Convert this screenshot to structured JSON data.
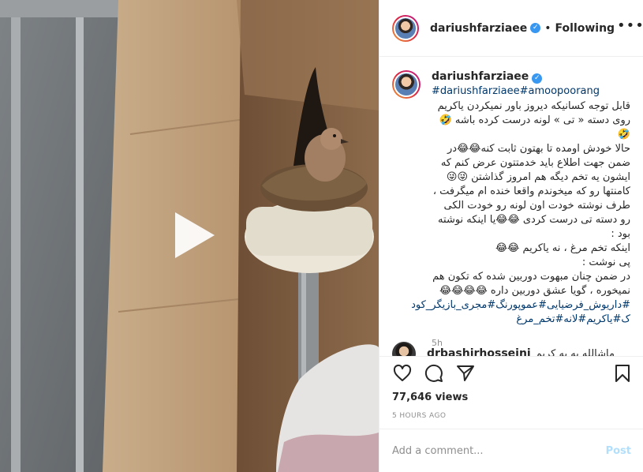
{
  "header": {
    "username": "dariushfarziaee",
    "separator": "•",
    "follow_state": "Following",
    "more_label": "•••"
  },
  "caption": {
    "username": "dariushfarziaee",
    "hashtags_top": "#dariushfarziaee#amoopoorang",
    "text": "قابل توجه کسانیکه دیروز باور نمیکردن یاکریم روی دسته « تی » لونه درست کرده باشه 🤣🤣\nحالا خودش اومده تا بهتون ثابت کنه😂😂در ضمن جهت اطلاع باید خدمتتون عرض کنم که ایشون یه تخم دیگه هم امروز گذاشتن 😜😜\nکامنتها رو که میخوندم واقعا خنده ام میگرفت ، طرف نوشته خودت اون لونه رو خودت الکی رو دسته تی درست کردی 😂😂یا اینکه نوشته بود :\nاینکه تخم مرغ ، نه یاکریم 😂😂\nپی نوشت :\nدر ضمن چنان مبهوت دوربین شده که تکون هم نمیخوره ، گویا عشق دوربین داره 😂😂😂😂",
    "tags": "#داریوش_فرضیایی#عموپورنگ#مجری_بازیگر_کود\nک#یاکریم#لانه#تخم_مرغ",
    "time": "5h"
  },
  "next_comment": {
    "username": "drbashirhosseini",
    "text": "ماشالله به یه کریم"
  },
  "actions": {
    "views": "77,646 views",
    "time_ago": "5 HOURS AGO"
  },
  "add_comment": {
    "placeholder": "Add a comment...",
    "post_label": "Post"
  },
  "icons": {
    "play": "play-icon",
    "like": "heart-icon",
    "comment": "comment-icon",
    "share": "share-icon",
    "save": "bookmark-icon",
    "verified": "verified-badge-icon",
    "more": "more-options-icon"
  },
  "colors": {
    "link_blue": "#00376b",
    "verified_blue": "#3897f0",
    "post_disabled": "#b2dffc",
    "muted_text": "#8e8e8e"
  }
}
